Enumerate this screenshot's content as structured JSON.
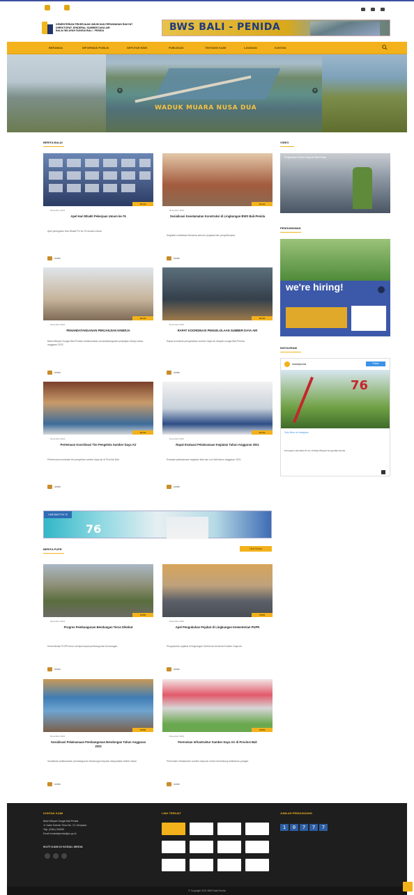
{
  "header": {
    "org_lines": [
      "KEMENTERIAN PEKERJAAN UMUM DAN PERUMAHAN RAKYAT",
      "DIREKTORAT JENDERAL SUMBER DAYA AIR",
      "BALAI WILAYAH SUNGAI BALI - PENIDA"
    ],
    "banner_text": "BWS BALI - PENIDA"
  },
  "nav": {
    "items": [
      "BERANDA",
      "INFORMASI PUBLIK",
      "SEPUTAR BWS",
      "PUBLIKASI",
      "TENTANG KAMI",
      "LAYANAN",
      "KONTAK"
    ]
  },
  "hero": {
    "caption": "WADUK MUARA NUSA DUA"
  },
  "berita_balai": {
    "title": "BERITA BALAI",
    "cards": [
      {
        "title": "Apel Hari Bhakti Pekerjaan Umum ke-76",
        "date": "Desember 2021",
        "excerpt": "Apel peringatan Hari Bhakti PU ke-76 secara virtual.",
        "author": "Admin",
        "badge": "Berita"
      },
      {
        "title": "Sosialisasi Keselamatan Konstruksi di Lingkungan BWS Bali-Penida",
        "date": "Desember 2021",
        "excerpt": "Kegiatan sosialisasi bersama seluruh pegawai dan penyedia jasa.",
        "author": "Admin",
        "badge": "Berita"
      },
      {
        "title": "PENANDATANGANAN PERJANJIAN KINERJA",
        "date": "Desember 2021",
        "excerpt": "Balai Wilayah Sungai Bali-Penida melaksanakan penandatanganan perjanjian kinerja tahun anggaran 2022.",
        "author": "Admin",
        "badge": "Berita"
      },
      {
        "title": "RAPAT KOORDINASI PENGELOLAAN SUMBER DAYA AIR",
        "date": "Desember 2021",
        "excerpt": "Rapat koordinasi pengelolaan sumber daya air wilayah sungai Bali-Penida.",
        "author": "Admin",
        "badge": "Berita"
      },
      {
        "title": "Pertemuan Koordinasi Tim Pengelola Sumber Daya Air",
        "date": "November 2021",
        "excerpt": "Pertemuan koordinasi tim pengelola sumber daya air di Provinsi Bali.",
        "author": "Admin",
        "badge": "Berita"
      },
      {
        "title": "Rapat Evaluasi Pelaksanaan Kegiatan Tahun Anggaran 2021",
        "date": "November 2021",
        "excerpt": "Evaluasi pelaksanaan kegiatan fisik dan non fisik tahun anggaran 2021.",
        "author": "Admin",
        "badge": "Berita"
      }
    ]
  },
  "berita_pupr": {
    "title": "BERITA PUPR",
    "more_label": "Lihat Semua",
    "cards": [
      {
        "title": "Progres Pembangunan Bendungan Terus Dikebut",
        "date": "Desember 2021",
        "excerpt": "Kementerian PUPR terus mempercepat pembangunan bendungan.",
        "author": "Admin",
        "badge": "PUPR"
      },
      {
        "title": "Apel Pengukuhan Pejabat di Lingkungan Kementerian PUPR",
        "date": "Desember 2021",
        "excerpt": "Pengukuhan pejabat di lingkungan Direktorat Jenderal Sumber Daya Air.",
        "author": "Admin",
        "badge": "PUPR"
      },
      {
        "title": "Sosialisasi Pelaksanaan Pembangunan Bendungan Tahun Anggaran 2022",
        "date": "Desember 2021",
        "excerpt": "Sosialisasi pelaksanaan pembangunan bendungan kepada masyarakat sekitar lokasi.",
        "author": "Admin",
        "badge": "PUPR"
      },
      {
        "title": "Peresmian Infrastruktur Sumber Daya Air di Provinsi Bali",
        "date": "Desember 2021",
        "excerpt": "Peresmian infrastruktur sumber daya air untuk mendukung ketahanan pangan.",
        "author": "Admin",
        "badge": "PUPR"
      }
    ]
  },
  "sidebar": {
    "video_title": "VIDEO",
    "video_label": "Pengelolaan Sumber Daya Air Bali-Penida",
    "pengumuman_title": "PENGUMUMAN",
    "hiring_text": "we're hiring!",
    "instagram_title": "INSTAGRAM",
    "ig_account": "bwsbalipenida",
    "ig_follow": "Follow",
    "ig_caption": "Peringatan Hari Bakti PU ke-76 Balai Wilayah Sungai Bali-Penida",
    "ig_view": "View More on Instagram"
  },
  "ad": {
    "text": "HARI BAKTI PU 76"
  },
  "footer": {
    "contact_title": "KONTAK KAMI",
    "contact_lines": [
      "Balai Wilayah Sungai Bali-Penida",
      "Jl. Gatot Subroto Timur No. 12, Denpasar",
      "Telp. (0361) 000000",
      "Email: bwsbalipenida@pu.go.id"
    ],
    "social_title": "IKUTI KAMI DI SOSIAL MEDIA",
    "links_title": "LINK TERKAIT",
    "visitors_title": "JUMLAH PENGUNJUNG",
    "counter": [
      "1",
      "0",
      "7",
      "7",
      "7"
    ],
    "copyright": "© Copyright 2021 BWS Bali-Penida"
  }
}
